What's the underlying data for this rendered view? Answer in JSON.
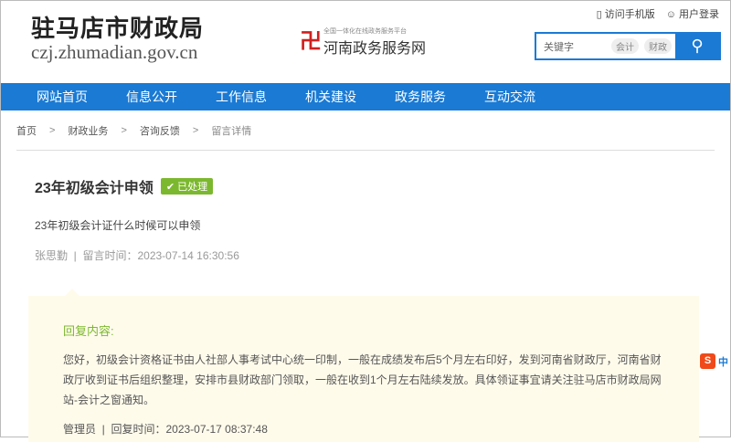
{
  "header": {
    "site_title": "驻马店市财政局",
    "site_url": "czj.zhumadian.gov.cn",
    "henan_small": "全国一体化在线政务服务平台",
    "henan_big": "河南政务服务网",
    "mobile": "访问手机版",
    "login": "用户登录"
  },
  "search": {
    "placeholder": "关键字",
    "tags": [
      "会计",
      "财政"
    ]
  },
  "nav": [
    "网站首页",
    "信息公开",
    "工作信息",
    "机关建设",
    "政务服务",
    "互动交流"
  ],
  "breadcrumb": [
    "首页",
    "财政业务",
    "咨询反馈",
    "留言详情"
  ],
  "question": {
    "title": "23年初级会计申领",
    "status": "已处理",
    "text": "23年初级会计证什么时候可以申领",
    "author": "张思勤",
    "time_label": "留言时间：2023-07-14 16:30:56"
  },
  "reply": {
    "heading": "回复内容:",
    "text": "您好，初级会计资格证书由人社部人事考试中心统一印制，一般在成绩发布后5个月左右印好，发到河南省财政厅，河南省财政厅收到证书后组织整理，安排市县财政部门领取，一般在收到1个月左右陆续发放。具体领证事宜请关注驻马店市财政局网站-会计之窗通知。",
    "author": "管理员",
    "time_label": "回复时间：2023-07-17 08:37:48"
  },
  "ime": {
    "label": "中"
  }
}
